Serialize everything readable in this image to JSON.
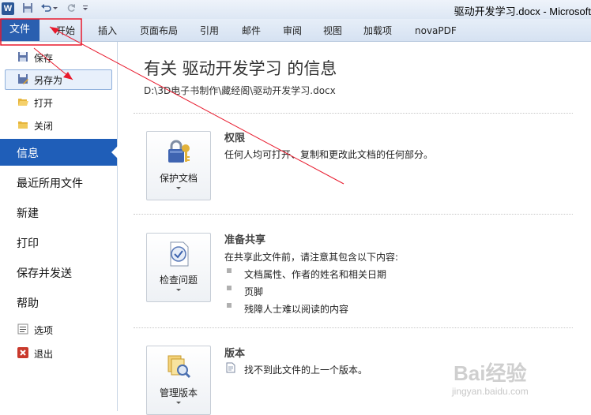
{
  "window": {
    "title": "驱动开发学习.docx - Microsoft",
    "app_icon_letter": "W"
  },
  "quick_access": {
    "save_icon": "save-icon",
    "undo_icon": "undo-icon",
    "redo_icon": "redo-icon",
    "customize_icon": "customize-icon"
  },
  "ribbon": {
    "tabs": [
      "文件",
      "开始",
      "插入",
      "页面布局",
      "引用",
      "邮件",
      "审阅",
      "视图",
      "加载项",
      "novaPDF"
    ]
  },
  "nav": {
    "small_items": [
      {
        "label": "保存",
        "icon": "save-icon"
      },
      {
        "label": "另存为",
        "icon": "save-as-icon"
      },
      {
        "label": "打开",
        "icon": "open-folder-icon"
      },
      {
        "label": "关闭",
        "icon": "close-folder-icon"
      }
    ],
    "big_items": [
      "信息",
      "最近所用文件",
      "新建",
      "打印",
      "保存并发送",
      "帮助"
    ],
    "bottom_items": [
      {
        "label": "选项",
        "icon": "options-icon"
      },
      {
        "label": "退出",
        "icon": "exit-icon"
      }
    ]
  },
  "info": {
    "title": "有关 驱动开发学习 的信息",
    "path": "D:\\3D电子书制作\\藏经阁\\驱动开发学习.docx"
  },
  "sections": {
    "permissions": {
      "button_label": "保护文档",
      "title": "权限",
      "description": "任何人均可打开、复制和更改此文档的任何部分。"
    },
    "prepare": {
      "button_label": "检查问题",
      "title": "准备共享",
      "description": "在共享此文件前，请注意其包含以下内容:",
      "bullets": [
        "文档属性、作者的姓名和相关日期",
        "页脚",
        "残障人士难以阅读的内容"
      ]
    },
    "versions": {
      "button_label": "管理版本",
      "title": "版本",
      "description": "找不到此文件的上一个版本。"
    }
  },
  "watermark": {
    "main": "Bai经验",
    "sub": "jingyan.baidu.com"
  },
  "colors": {
    "file_tab": "#2a5fb0",
    "active_nav": "#1f5eb8",
    "annotation": "#e8192c"
  }
}
